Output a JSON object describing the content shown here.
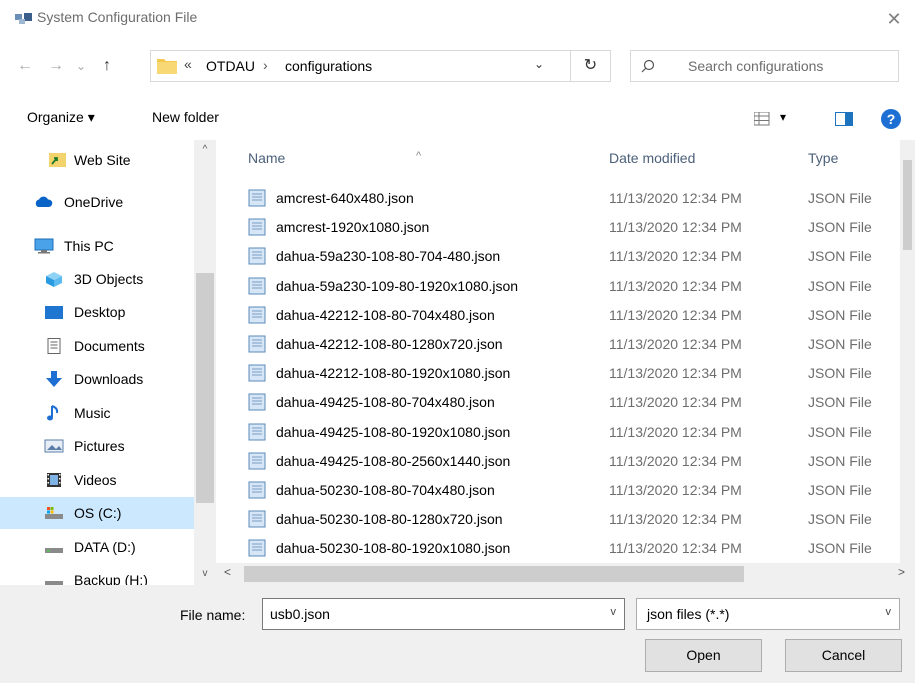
{
  "window": {
    "title": "System Configuration File",
    "close_label": "✕"
  },
  "nav": {
    "back_icon": "←",
    "forward_icon": "→",
    "recent_icon": "⌄",
    "up_icon": "↑",
    "chevron_label": "«",
    "path_segments": [
      "OTDAU",
      "configurations"
    ],
    "separator": "›",
    "dropdown_icon": "⌄",
    "refresh_icon": "↻",
    "search_placeholder": "Search configurations"
  },
  "toolbar": {
    "organize_label": "Organize ▾",
    "new_folder_label": "New folder",
    "view_dropdown": "▾",
    "help_label": "?"
  },
  "sidebar": {
    "items": [
      {
        "label": "Web Site",
        "icon": "shortcut-icon"
      },
      {
        "label": "OneDrive",
        "icon": "cloud-icon"
      },
      {
        "label": "This PC",
        "icon": "monitor-icon"
      },
      {
        "label": "3D Objects",
        "icon": "cube-icon"
      },
      {
        "label": "Desktop",
        "icon": "desktop-icon"
      },
      {
        "label": "Documents",
        "icon": "document-icon"
      },
      {
        "label": "Downloads",
        "icon": "download-icon"
      },
      {
        "label": "Music",
        "icon": "music-icon"
      },
      {
        "label": "Pictures",
        "icon": "pictures-icon"
      },
      {
        "label": "Videos",
        "icon": "videos-icon"
      },
      {
        "label": "OS (C:)",
        "icon": "drive-icon"
      },
      {
        "label": "DATA (D:)",
        "icon": "drive-icon"
      },
      {
        "label": "Backup (H:)",
        "icon": "drive-icon"
      }
    ],
    "selected": "OS (C:)"
  },
  "columns": {
    "name": "Name",
    "date": "Date modified",
    "type": "Type"
  },
  "files": [
    {
      "name": "amcrest-640x480.json",
      "date": "11/13/2020 12:34 PM",
      "type": "JSON File"
    },
    {
      "name": "amcrest-1920x1080.json",
      "date": "11/13/2020 12:34 PM",
      "type": "JSON File"
    },
    {
      "name": "dahua-59a230-108-80-704-480.json",
      "date": "11/13/2020 12:34 PM",
      "type": "JSON File"
    },
    {
      "name": "dahua-59a230-109-80-1920x1080.json",
      "date": "11/13/2020 12:34 PM",
      "type": "JSON File"
    },
    {
      "name": "dahua-42212-108-80-704x480.json",
      "date": "11/13/2020 12:34 PM",
      "type": "JSON File"
    },
    {
      "name": "dahua-42212-108-80-1280x720.json",
      "date": "11/13/2020 12:34 PM",
      "type": "JSON File"
    },
    {
      "name": "dahua-42212-108-80-1920x1080.json",
      "date": "11/13/2020 12:34 PM",
      "type": "JSON File"
    },
    {
      "name": "dahua-49425-108-80-704x480.json",
      "date": "11/13/2020 12:34 PM",
      "type": "JSON File"
    },
    {
      "name": "dahua-49425-108-80-1920x1080.json",
      "date": "11/13/2020 12:34 PM",
      "type": "JSON File"
    },
    {
      "name": "dahua-49425-108-80-2560x1440.json",
      "date": "11/13/2020 12:34 PM",
      "type": "JSON File"
    },
    {
      "name": "dahua-50230-108-80-704x480.json",
      "date": "11/13/2020 12:34 PM",
      "type": "JSON File"
    },
    {
      "name": "dahua-50230-108-80-1280x720.json",
      "date": "11/13/2020 12:34 PM",
      "type": "JSON File"
    },
    {
      "name": "dahua-50230-108-80-1920x1080.json",
      "date": "11/13/2020 12:34 PM",
      "type": "JSON File"
    }
  ],
  "footer": {
    "file_name_label": "File name:",
    "file_name_value": "usb0.json",
    "filter_value": "json files (*.*)",
    "open_label": "Open",
    "cancel_label": "Cancel"
  },
  "colors": {
    "selection": "#cce8ff",
    "accent": "#1e6fd4",
    "folder": "#f3c94f"
  }
}
